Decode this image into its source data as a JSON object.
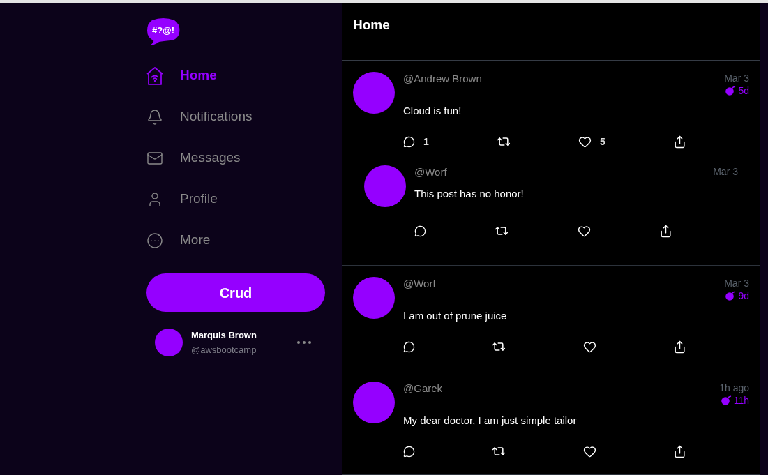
{
  "logo": {
    "text": "#?@!"
  },
  "nav": [
    {
      "kind": "home",
      "label": "Home",
      "selected": true
    },
    {
      "kind": "notifications",
      "label": "Notifications",
      "selected": false
    },
    {
      "kind": "messages",
      "label": "Messages",
      "selected": false
    },
    {
      "kind": "profile",
      "label": "Profile",
      "selected": false
    },
    {
      "kind": "more",
      "label": "More",
      "selected": false
    }
  ],
  "post_button": {
    "label": "Crud"
  },
  "profile": {
    "name": "Marquis Brown",
    "handle": "@awsbootcamp"
  },
  "feed": {
    "title": "Home",
    "activities": [
      {
        "handle": "@Andrew Brown",
        "message": "Cloud is fun!",
        "created": "Mar 3",
        "expires": "5d",
        "replies_count": "1",
        "likes_count": "5",
        "replies": [
          {
            "handle": "@Worf",
            "message": "This post has no honor!",
            "created": "Mar 3"
          }
        ]
      },
      {
        "handle": "@Worf",
        "message": "I am out of prune juice",
        "created": "Mar 3",
        "expires": "9d"
      },
      {
        "handle": "@Garek",
        "message": "My dear doctor, I am just simple tailor",
        "created": "1h ago",
        "expires": "11h"
      }
    ]
  }
}
